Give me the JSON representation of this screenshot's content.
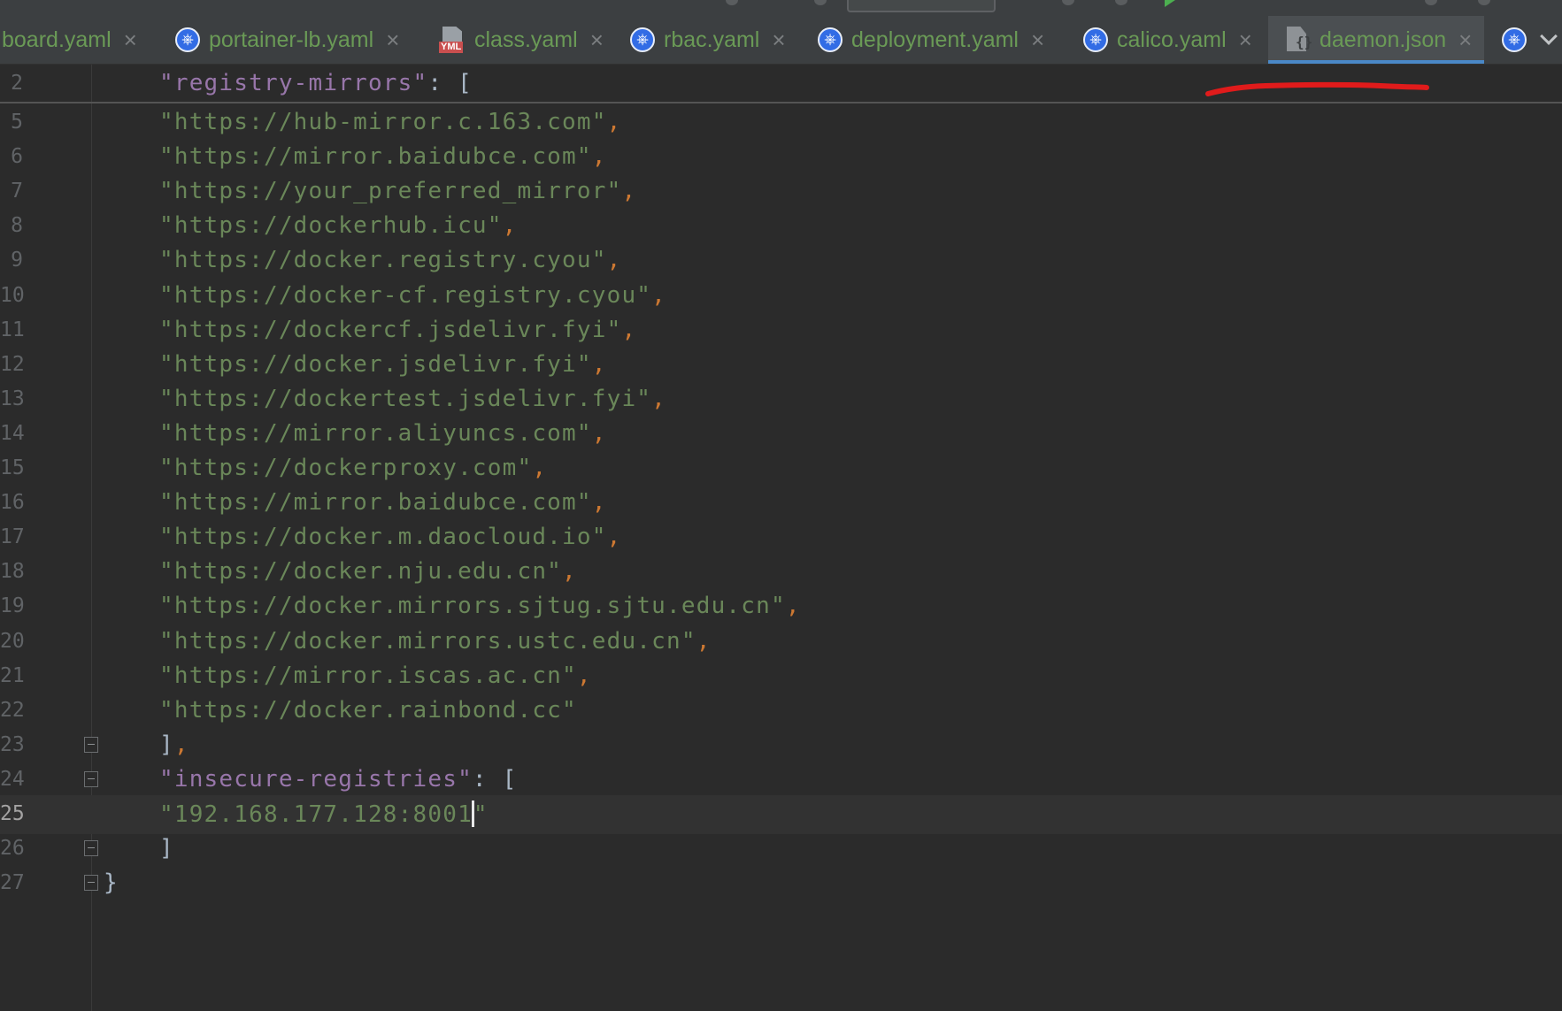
{
  "tabs": [
    {
      "label": "board.yaml",
      "icon": "kubernetes-icon",
      "active": false
    },
    {
      "label": "portainer-lb.yaml",
      "icon": "kubernetes-icon",
      "active": false
    },
    {
      "label": "class.yaml",
      "icon": "yml-file-icon",
      "icon_text": "YML",
      "active": false
    },
    {
      "label": "rbac.yaml",
      "icon": "kubernetes-icon",
      "active": false
    },
    {
      "label": "deployment.yaml",
      "icon": "kubernetes-icon",
      "active": false
    },
    {
      "label": "calico.yaml",
      "icon": "kubernetes-icon",
      "active": false
    },
    {
      "label": "daemon.json",
      "icon": "json-file-icon",
      "active": true
    }
  ],
  "editor": {
    "sticky_line": {
      "num": "2",
      "key": "\"registry-mirrors\"",
      "rest": ": ["
    },
    "lines": [
      {
        "num": "5",
        "text": "\"https://hub-mirror.c.163.com\"",
        "trail": ","
      },
      {
        "num": "6",
        "text": "\"https://mirror.baidubce.com\"",
        "trail": ","
      },
      {
        "num": "7",
        "text": "\"https://your_preferred_mirror\"",
        "trail": ","
      },
      {
        "num": "8",
        "text": "\"https://dockerhub.icu\"",
        "trail": ","
      },
      {
        "num": "9",
        "text": "\"https://docker.registry.cyou\"",
        "trail": ","
      },
      {
        "num": "10",
        "text": "\"https://docker-cf.registry.cyou\"",
        "trail": ","
      },
      {
        "num": "11",
        "text": "\"https://dockercf.jsdelivr.fyi\"",
        "trail": ","
      },
      {
        "num": "12",
        "text": "\"https://docker.jsdelivr.fyi\"",
        "trail": ","
      },
      {
        "num": "13",
        "text": "\"https://dockertest.jsdelivr.fyi\"",
        "trail": ","
      },
      {
        "num": "14",
        "text": "\"https://mirror.aliyuncs.com\"",
        "trail": ","
      },
      {
        "num": "15",
        "text": "\"https://dockerproxy.com\"",
        "trail": ","
      },
      {
        "num": "16",
        "text": "\"https://mirror.baidubce.com\"",
        "trail": ","
      },
      {
        "num": "17",
        "text": "\"https://docker.m.daocloud.io\"",
        "trail": ","
      },
      {
        "num": "18",
        "text": "\"https://docker.nju.edu.cn\"",
        "trail": ","
      },
      {
        "num": "19",
        "text": "\"https://docker.mirrors.sjtug.sjtu.edu.cn\"",
        "trail": ","
      },
      {
        "num": "20",
        "text": "\"https://docker.mirrors.ustc.edu.cn\"",
        "trail": ","
      },
      {
        "num": "21",
        "text": "\"https://mirror.iscas.ac.cn\"",
        "trail": ","
      },
      {
        "num": "22",
        "text": "\"https://docker.rainbond.cc\"",
        "trail": ""
      },
      {
        "num": "23",
        "bracket": "]",
        "trail": ","
      },
      {
        "num": "24",
        "key": "\"insecure-registries\"",
        "rest": ": ["
      },
      {
        "num": "25",
        "value_before_caret": "\"192.168.177.128:8001",
        "value_after_caret": "\""
      },
      {
        "num": "26",
        "bracket": "]"
      },
      {
        "num": "27",
        "brace": "}"
      }
    ]
  },
  "colors": {
    "background": "#2b2b2b",
    "string": "#6a8759",
    "key": "#9876aa",
    "punctuation": "#cc7832",
    "annotation": "#e01b1b",
    "tab_text": "#6a9a56",
    "active_tab_underline": "#4a88c7"
  }
}
